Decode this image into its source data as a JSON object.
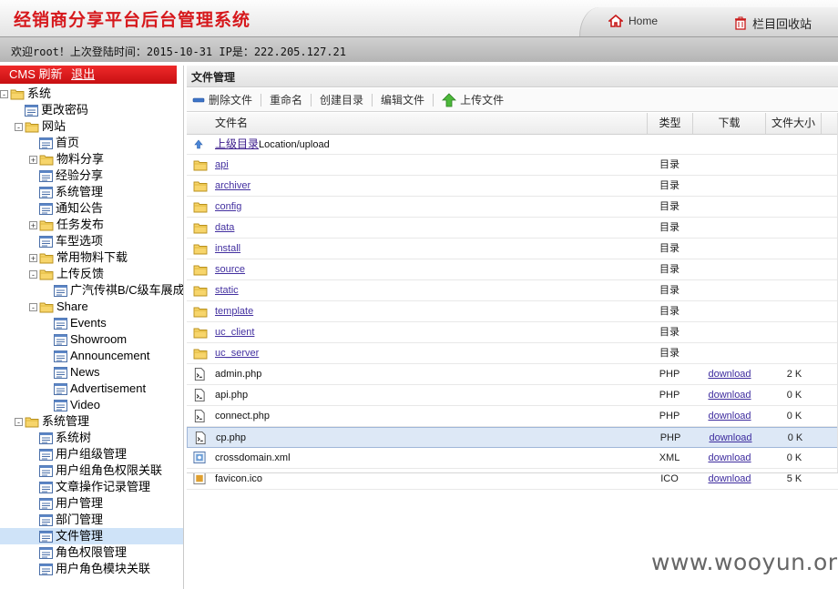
{
  "header": {
    "title": "经销商分享平台后台管理系统",
    "home_label": "Home",
    "recycle_label": "栏目回收站"
  },
  "infobar": {
    "welcome": "欢迎root！上次登陆时间：2015-10-31 IP是：222.205.127.21"
  },
  "sidebar": {
    "cms_label": "CMS",
    "refresh_label": "刷新",
    "logout_label": "退出",
    "tree": [
      {
        "label": "系统",
        "type": "folder",
        "level": 0,
        "toggle": "-"
      },
      {
        "label": "更改密码",
        "type": "page",
        "level": 1
      },
      {
        "label": "网站",
        "type": "folder",
        "level": 1,
        "toggle": "-"
      },
      {
        "label": "首页",
        "type": "page",
        "level": 2
      },
      {
        "label": "物料分享",
        "type": "folder",
        "level": 2,
        "toggle": "+"
      },
      {
        "label": "经验分享",
        "type": "page",
        "level": 2
      },
      {
        "label": "系统管理",
        "type": "page",
        "level": 2
      },
      {
        "label": "通知公告",
        "type": "page",
        "level": 2
      },
      {
        "label": "任务发布",
        "type": "folder",
        "level": 2,
        "toggle": "+"
      },
      {
        "label": "车型选项",
        "type": "page",
        "level": 2
      },
      {
        "label": "常用物料下载",
        "type": "folder",
        "level": 2,
        "toggle": "+"
      },
      {
        "label": "上传反馈",
        "type": "folder",
        "level": 2,
        "toggle": "-"
      },
      {
        "label": "广汽传祺B/C级车展成交",
        "type": "page",
        "level": 3
      },
      {
        "label": "Share",
        "type": "folder",
        "level": 2,
        "toggle": "-"
      },
      {
        "label": "Events",
        "type": "page",
        "level": 3
      },
      {
        "label": "Showroom",
        "type": "page",
        "level": 3
      },
      {
        "label": "Announcement",
        "type": "page",
        "level": 3
      },
      {
        "label": "News",
        "type": "page",
        "level": 3
      },
      {
        "label": "Advertisement",
        "type": "page",
        "level": 3
      },
      {
        "label": "Video",
        "type": "page",
        "level": 3
      },
      {
        "label": "系统管理",
        "type": "folder",
        "level": 1,
        "toggle": "-"
      },
      {
        "label": "系统树",
        "type": "page",
        "level": 2
      },
      {
        "label": "用户组级管理",
        "type": "page",
        "level": 2
      },
      {
        "label": "用户组角色权限关联",
        "type": "page",
        "level": 2
      },
      {
        "label": "文章操作记录管理",
        "type": "page",
        "level": 2
      },
      {
        "label": "用户管理",
        "type": "page",
        "level": 2
      },
      {
        "label": "部门管理",
        "type": "page",
        "level": 2
      },
      {
        "label": "文件管理",
        "type": "page",
        "level": 2,
        "selected": true
      },
      {
        "label": "角色权限管理",
        "type": "page",
        "level": 2
      },
      {
        "label": "用户角色模块关联",
        "type": "page",
        "level": 2
      }
    ]
  },
  "main": {
    "panel_title": "文件管理",
    "toolbar": {
      "delete_label": "删除文件",
      "rename_label": "重命名",
      "mkdir_label": "创建目录",
      "edit_label": "编辑文件",
      "upload_label": "上传文件"
    },
    "columns": {
      "name": "文件名",
      "type": "类型",
      "download": "下载",
      "size": "文件大小"
    },
    "parent_row": {
      "link": "上级目录",
      "location": "Location/upload"
    },
    "rows": [
      {
        "name": "api",
        "kind": "dir",
        "type": "目录",
        "download": "",
        "size": ""
      },
      {
        "name": "archiver",
        "kind": "dir",
        "type": "目录",
        "download": "",
        "size": ""
      },
      {
        "name": "config",
        "kind": "dir",
        "type": "目录",
        "download": "",
        "size": ""
      },
      {
        "name": "data",
        "kind": "dir",
        "type": "目录",
        "download": "",
        "size": ""
      },
      {
        "name": "install",
        "kind": "dir",
        "type": "目录",
        "download": "",
        "size": ""
      },
      {
        "name": "source",
        "kind": "dir",
        "type": "目录",
        "download": "",
        "size": ""
      },
      {
        "name": "static",
        "kind": "dir",
        "type": "目录",
        "download": "",
        "size": ""
      },
      {
        "name": "template",
        "kind": "dir",
        "type": "目录",
        "download": "",
        "size": ""
      },
      {
        "name": "uc_client",
        "kind": "dir",
        "type": "目录",
        "download": "",
        "size": ""
      },
      {
        "name": "uc_server",
        "kind": "dir",
        "type": "目录",
        "download": "",
        "size": ""
      },
      {
        "name": "admin.php",
        "kind": "php",
        "type": "PHP",
        "download": "download",
        "size": "2 K"
      },
      {
        "name": "api.php",
        "kind": "php",
        "type": "PHP",
        "download": "download",
        "size": "0 K"
      },
      {
        "name": "connect.php",
        "kind": "php",
        "type": "PHP",
        "download": "download",
        "size": "0 K"
      },
      {
        "name": "cp.php",
        "kind": "php",
        "type": "PHP",
        "download": "download",
        "size": "0 K",
        "highlight": true
      },
      {
        "name": "crossdomain.xml",
        "kind": "xml",
        "type": "XML",
        "download": "download",
        "size": "0 K"
      },
      {
        "name": "favicon.ico",
        "kind": "ico",
        "type": "ICO",
        "download": "download",
        "size": "5 K"
      }
    ]
  },
  "watermark": "www.wooyun.org",
  "colors": {
    "brand_red": "#d6181c",
    "link": "#4330a0",
    "selection": "#cfe3f8"
  }
}
